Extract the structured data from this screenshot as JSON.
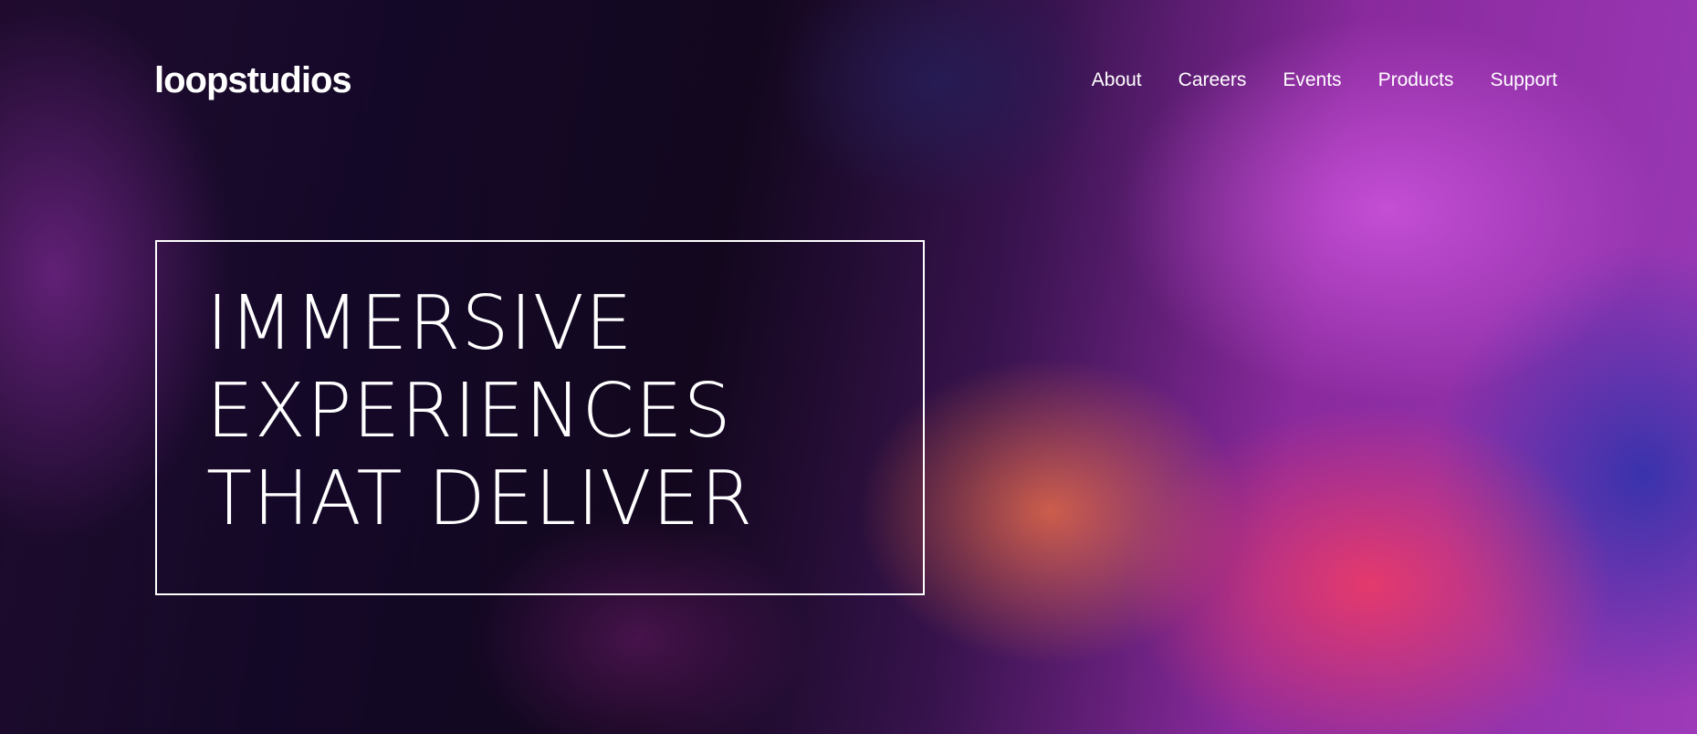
{
  "header": {
    "logo": "loopstudios",
    "nav": [
      {
        "label": "About"
      },
      {
        "label": "Careers"
      },
      {
        "label": "Events"
      },
      {
        "label": "Products"
      },
      {
        "label": "Support"
      }
    ]
  },
  "hero": {
    "headline_lines": [
      "IMMERSIVE",
      "EXPERIENCES",
      "THAT DELIVER"
    ],
    "image_description": "",
    "colors": {
      "text": "#ffffff",
      "accent_magenta": "#9c3ab8",
      "accent_red": "#fa3c5f",
      "accent_blue": "#2832aa"
    }
  }
}
